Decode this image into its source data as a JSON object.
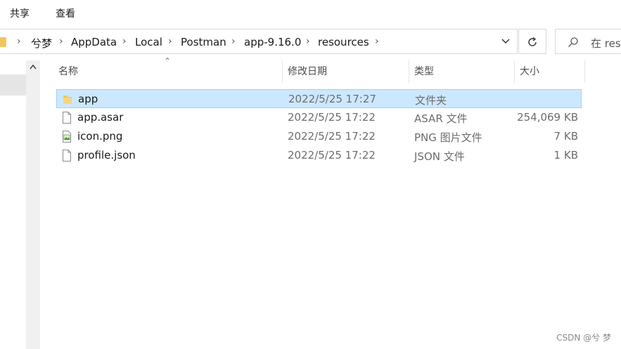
{
  "ribbon": {
    "tabs": [
      "共享",
      "查看"
    ]
  },
  "address": {
    "path": [
      "兮梦",
      "AppData",
      "Local",
      "Postman",
      "app-9.16.0",
      "resources"
    ]
  },
  "search": {
    "placeholder": "在 reso"
  },
  "columns": {
    "name": "名称",
    "date": "修改日期",
    "type": "类型",
    "size": "大小"
  },
  "files": [
    {
      "name": "app",
      "date": "2022/5/25 17:27",
      "type": "文件夹",
      "size": "",
      "icon": "folder-icon",
      "selected": true
    },
    {
      "name": "app.asar",
      "date": "2022/5/25 17:22",
      "type": "ASAR 文件",
      "size": "254,069 KB",
      "icon": "file-icon",
      "selected": false
    },
    {
      "name": "icon.png",
      "date": "2022/5/25 17:22",
      "type": "PNG 图片文件",
      "size": "7 KB",
      "icon": "image-file-icon",
      "selected": false
    },
    {
      "name": "profile.json",
      "date": "2022/5/25 17:22",
      "type": "JSON 文件",
      "size": "1 KB",
      "icon": "file-icon",
      "selected": false
    }
  ],
  "watermark": "CSDN @兮 梦",
  "colors": {
    "selection_bg": "#cce8ff",
    "selection_border": "#99d1ff",
    "folder": "#f2c55c"
  }
}
